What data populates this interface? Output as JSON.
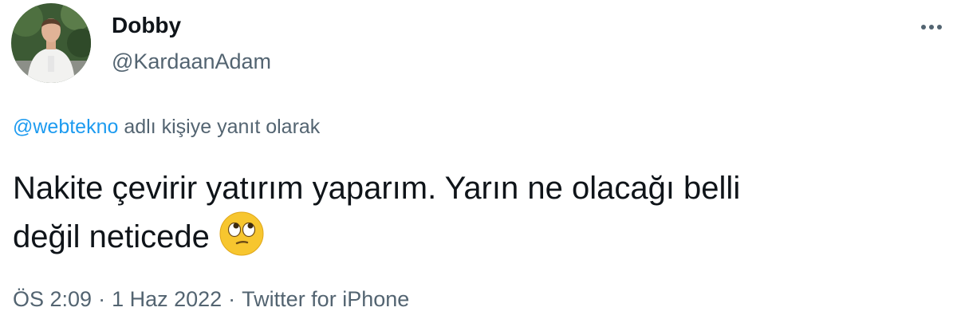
{
  "author": {
    "display_name": "Dobby",
    "handle": "@KardaanAdam",
    "avatar_icon": "profile-photo"
  },
  "reply_context": {
    "mention": "@webtekno",
    "suffix": "adlı kişiye yanıt olarak"
  },
  "tweet": {
    "line1": "Nakite çevirir yatırım yaparım. Yarın ne olacağı belli",
    "line2": "değil neticede",
    "emoji": "face-with-rolling-eyes"
  },
  "meta": {
    "time": "ÖS 2:09",
    "separator": "·",
    "date": "1 Haz 2022",
    "source": "Twitter for iPhone"
  },
  "colors": {
    "text": "#0f1419",
    "secondary": "#536471",
    "link": "#1d9bf0"
  },
  "icons": {
    "more": "more-horizontal-icon"
  }
}
